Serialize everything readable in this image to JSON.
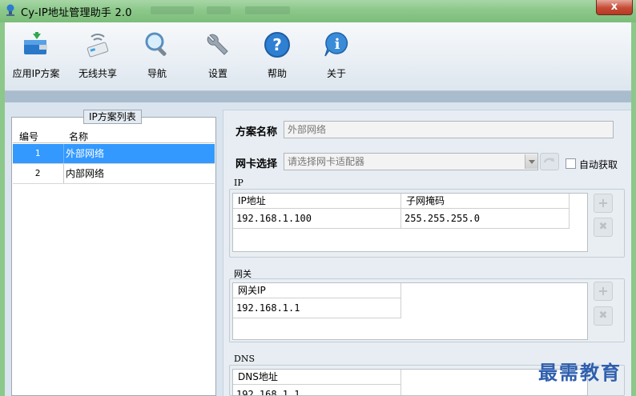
{
  "window": {
    "title": "Cy-IP地址管理助手 2.0",
    "close_label": "x"
  },
  "toolbar": {
    "items": [
      {
        "label": "应用IP方案",
        "icon": "apply-icon"
      },
      {
        "label": "无线共享",
        "icon": "wireless-icon"
      },
      {
        "label": "导航",
        "icon": "search-icon"
      },
      {
        "label": "设置",
        "icon": "wrench-icon"
      },
      {
        "label": "帮助",
        "icon": "help-icon"
      },
      {
        "label": "关于",
        "icon": "info-icon"
      }
    ]
  },
  "plan_list": {
    "caption": "IP方案列表",
    "columns": [
      "编号",
      "名称"
    ],
    "rows": [
      {
        "num": "1",
        "name": "外部网络",
        "selected": true
      },
      {
        "num": "2",
        "name": "内部网络",
        "selected": false
      }
    ]
  },
  "detail": {
    "plan_name_label": "方案名称",
    "plan_name_value": "外部网络",
    "nic_label": "网卡选择",
    "nic_placeholder": "请选择网卡适配器",
    "auto_label": "自动获取",
    "ip_section": {
      "caption": "IP",
      "columns": [
        "IP地址",
        "子网掩码"
      ],
      "rows": [
        [
          "192.168.1.100",
          "255.255.255.0"
        ]
      ]
    },
    "gateway_section": {
      "caption": "网关",
      "columns": [
        "网关IP"
      ],
      "rows": [
        [
          "192.168.1.1"
        ]
      ]
    },
    "dns_section": {
      "caption": "DNS",
      "columns": [
        "DNS地址"
      ],
      "rows": [
        [
          "192.168.1.1"
        ]
      ]
    },
    "add_symbol": "+",
    "remove_symbol": "✖"
  },
  "watermark": "最需教育",
  "colors": {
    "selection": "#3399ff",
    "titlebar": "#8cc88a",
    "accent_blue": "#2f5fae"
  }
}
